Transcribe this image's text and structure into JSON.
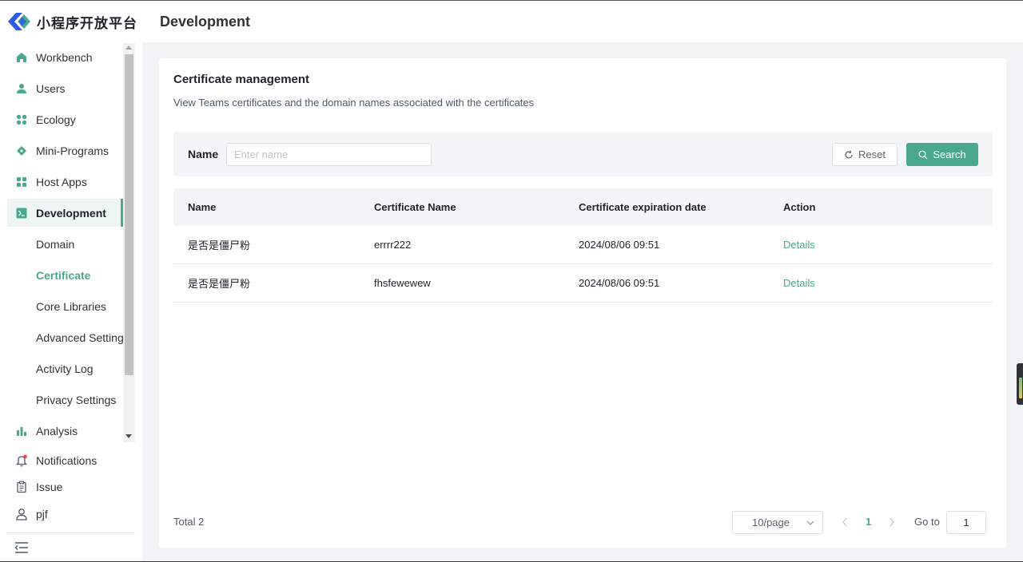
{
  "app": {
    "logo_text": "小程序开放平台",
    "brand_color": "#4aa88e"
  },
  "header": {
    "title": "Development"
  },
  "sidebar": {
    "items": [
      {
        "label": "Workbench",
        "icon": "home-icon"
      },
      {
        "label": "Users",
        "icon": "user-icon"
      },
      {
        "label": "Ecology",
        "icon": "grid-icon"
      },
      {
        "label": "Mini-Programs",
        "icon": "diamond-icon"
      },
      {
        "label": "Host Apps",
        "icon": "apps-icon"
      },
      {
        "label": "Development",
        "icon": "terminal-icon",
        "active": true
      },
      {
        "label": "Domain"
      },
      {
        "label": "Certificate",
        "selected": true
      },
      {
        "label": "Core Libraries"
      },
      {
        "label": "Advanced Settings"
      },
      {
        "label": "Activity Log"
      },
      {
        "label": "Privacy Settings"
      },
      {
        "label": "Analysis",
        "icon": "bar-chart-icon"
      }
    ],
    "bottom": {
      "notifications": "Notifications",
      "issue": "Issue",
      "user": "pjf"
    }
  },
  "card": {
    "title": "Certificate management",
    "description": "View Teams certificates and the domain names associated with the certificates"
  },
  "filter": {
    "name_label": "Name",
    "name_placeholder": "Enter name",
    "reset_label": "Reset",
    "search_label": "Search"
  },
  "table": {
    "columns": [
      "Name",
      "Certificate Name",
      "Certificate expiration date",
      "Action"
    ],
    "rows": [
      {
        "name": "是否是僵尸粉",
        "certificate_name": "errrr222",
        "expiration": "2024/08/06 09:51",
        "action": "Details"
      },
      {
        "name": "是否是僵尸粉",
        "certificate_name": "fhsfewewew",
        "expiration": "2024/08/06 09:51",
        "action": "Details"
      }
    ]
  },
  "pagination": {
    "total": "Total 2",
    "page_size": "10/page",
    "current_page": "1",
    "goto_label": "Go to",
    "goto_value": "1"
  }
}
